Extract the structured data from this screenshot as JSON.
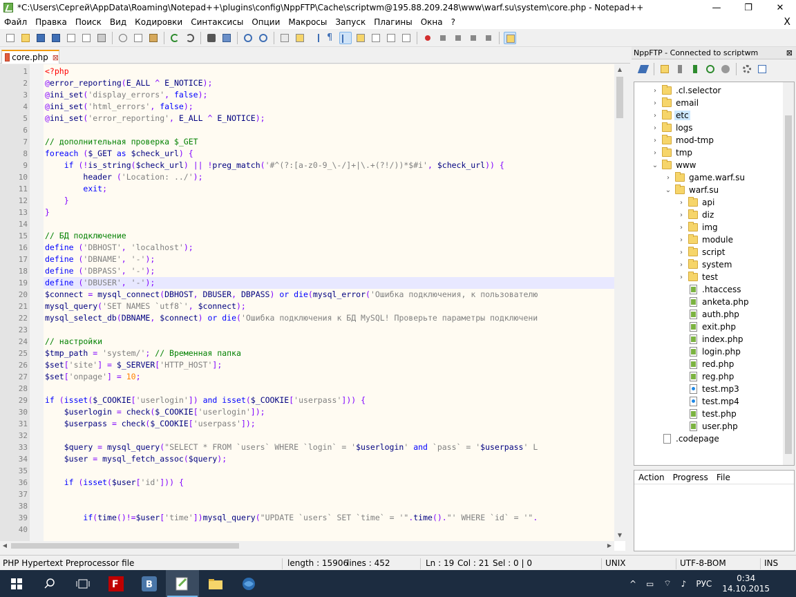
{
  "window": {
    "title": "*C:\\Users\\Сергей\\AppData\\Roaming\\Notepad++\\plugins\\config\\NppFTP\\Cache\\scriptwm@195.88.209.248\\www\\warf.su\\system\\core.php - Notepad++",
    "minimize": "—",
    "maximize": "❐",
    "close": "✕"
  },
  "menu": {
    "items": [
      "Файл",
      "Правка",
      "Поиск",
      "Вид",
      "Кодировки",
      "Синтаксисы",
      "Опции",
      "Макросы",
      "Запуск",
      "Плагины",
      "Окна",
      "?"
    ],
    "close": "X"
  },
  "tab": {
    "label": "core.php",
    "close": "⊠"
  },
  "code": {
    "line_numbers": [
      "1",
      "2",
      "3",
      "4",
      "5",
      "6",
      "7",
      "8",
      "9",
      "10",
      "11",
      "12",
      "13",
      "14",
      "15",
      "16",
      "17",
      "18",
      "19",
      "20",
      "21",
      "22",
      "23",
      "24",
      "25",
      "26",
      "27",
      "28",
      "29",
      "30",
      "31",
      "32",
      "33",
      "34",
      "35",
      "36",
      "37",
      "38",
      "39",
      "40"
    ],
    "current_line": 19,
    "lines": [
      [
        [
          "php",
          "<?php"
        ]
      ],
      [
        [
          "op",
          "@"
        ],
        [
          "fn",
          "error_reporting"
        ],
        [
          "op",
          "("
        ],
        [
          "fn",
          "E_ALL"
        ],
        [
          "op",
          " ^ "
        ],
        [
          "fn",
          "E_NOTICE"
        ],
        [
          "op",
          ");"
        ]
      ],
      [
        [
          "op",
          "@"
        ],
        [
          "fn",
          "ini_set"
        ],
        [
          "op",
          "("
        ],
        [
          "str",
          "'display_errors'"
        ],
        [
          "op",
          ", "
        ],
        [
          "kw",
          "false"
        ],
        [
          "op",
          ");"
        ]
      ],
      [
        [
          "op",
          "@"
        ],
        [
          "fn",
          "ini_set"
        ],
        [
          "op",
          "("
        ],
        [
          "str",
          "'html_errors'"
        ],
        [
          "op",
          ", "
        ],
        [
          "kw",
          "false"
        ],
        [
          "op",
          ");"
        ]
      ],
      [
        [
          "op",
          "@"
        ],
        [
          "fn",
          "ini_set"
        ],
        [
          "op",
          "("
        ],
        [
          "str",
          "'error_reporting'"
        ],
        [
          "op",
          ", "
        ],
        [
          "fn",
          "E_ALL"
        ],
        [
          "op",
          " ^ "
        ],
        [
          "fn",
          "E_NOTICE"
        ],
        [
          "op",
          ");"
        ]
      ],
      [],
      [
        [
          "cmt",
          "// дополнительная проверка $_GET"
        ]
      ],
      [
        [
          "kw",
          "foreach"
        ],
        [
          "op",
          " ("
        ],
        [
          "var",
          "$_GET"
        ],
        [
          "kw",
          " as "
        ],
        [
          "var",
          "$check_url"
        ],
        [
          "op",
          ") {"
        ]
      ],
      [
        [
          "op",
          "    "
        ],
        [
          "kw",
          "if"
        ],
        [
          "op",
          " (!"
        ],
        [
          "fn",
          "is_string"
        ],
        [
          "op",
          "("
        ],
        [
          "var",
          "$check_url"
        ],
        [
          "op",
          ") || !"
        ],
        [
          "fn",
          "preg_match"
        ],
        [
          "op",
          "("
        ],
        [
          "str",
          "'#^(?:[a-z0-9_\\-/]+|\\.+(?!/))*$#i'"
        ],
        [
          "op",
          ", "
        ],
        [
          "var",
          "$check_url"
        ],
        [
          "op",
          ")) {"
        ]
      ],
      [
        [
          "op",
          "        "
        ],
        [
          "fn",
          "header"
        ],
        [
          "op",
          " ("
        ],
        [
          "str",
          "'Location: ../'"
        ],
        [
          "op",
          ");"
        ]
      ],
      [
        [
          "op",
          "        "
        ],
        [
          "kw",
          "exit"
        ],
        [
          "op",
          ";"
        ]
      ],
      [
        [
          "op",
          "    }"
        ]
      ],
      [
        [
          "op",
          "}"
        ]
      ],
      [],
      [
        [
          "cmt",
          "// БД подключение"
        ]
      ],
      [
        [
          "kw",
          "define"
        ],
        [
          "op",
          " ("
        ],
        [
          "str",
          "'DBHOST'"
        ],
        [
          "op",
          ", "
        ],
        [
          "str",
          "'localhost'"
        ],
        [
          "op",
          ");"
        ]
      ],
      [
        [
          "kw",
          "define"
        ],
        [
          "op",
          " ("
        ],
        [
          "str",
          "'DBNAME'"
        ],
        [
          "op",
          ", "
        ],
        [
          "str",
          "'-'"
        ],
        [
          "op",
          ");"
        ]
      ],
      [
        [
          "kw",
          "define"
        ],
        [
          "op",
          " ("
        ],
        [
          "str",
          "'DBPASS'"
        ],
        [
          "op",
          ", "
        ],
        [
          "str",
          "'-'"
        ],
        [
          "op",
          ");"
        ]
      ],
      [
        [
          "kw",
          "define"
        ],
        [
          "op",
          " ("
        ],
        [
          "str",
          "'DBUSER'"
        ],
        [
          "op",
          ", "
        ],
        [
          "str",
          "'-'"
        ],
        [
          "op",
          ");"
        ]
      ],
      [
        [
          "var",
          "$connect"
        ],
        [
          "op",
          " = "
        ],
        [
          "fn",
          "mysql_connect"
        ],
        [
          "op",
          "("
        ],
        [
          "fn",
          "DBHOST"
        ],
        [
          "op",
          ", "
        ],
        [
          "fn",
          "DBUSER"
        ],
        [
          "op",
          ", "
        ],
        [
          "fn",
          "DBPASS"
        ],
        [
          "op",
          ") "
        ],
        [
          "kw",
          "or"
        ],
        [
          "op",
          " "
        ],
        [
          "kw",
          "die"
        ],
        [
          "op",
          "("
        ],
        [
          "fn",
          "mysql_error"
        ],
        [
          "op",
          "("
        ],
        [
          "str",
          "'Ошибка подключения, к пользователю"
        ]
      ],
      [
        [
          "fn",
          "mysql_query"
        ],
        [
          "op",
          "("
        ],
        [
          "str",
          "'SET NAMES `utf8`'"
        ],
        [
          "op",
          ", "
        ],
        [
          "var",
          "$connect"
        ],
        [
          "op",
          ");"
        ]
      ],
      [
        [
          "fn",
          "mysql_select_db"
        ],
        [
          "op",
          "("
        ],
        [
          "fn",
          "DBNAME"
        ],
        [
          "op",
          ", "
        ],
        [
          "var",
          "$connect"
        ],
        [
          "op",
          ") "
        ],
        [
          "kw",
          "or"
        ],
        [
          "op",
          " "
        ],
        [
          "kw",
          "die"
        ],
        [
          "op",
          "("
        ],
        [
          "str",
          "'Ошибка подключения к БД MySQL! Проверьте параметры подключени"
        ]
      ],
      [],
      [
        [
          "cmt",
          "// настройки"
        ]
      ],
      [
        [
          "var",
          "$tmp_path"
        ],
        [
          "op",
          " = "
        ],
        [
          "str",
          "'system/'"
        ],
        [
          "op",
          "; "
        ],
        [
          "cmt",
          "// Временная папка"
        ]
      ],
      [
        [
          "var",
          "$set"
        ],
        [
          "op",
          "["
        ],
        [
          "str",
          "'site'"
        ],
        [
          "op",
          "] = "
        ],
        [
          "var",
          "$_SERVER"
        ],
        [
          "op",
          "["
        ],
        [
          "str",
          "'HTTP_HOST'"
        ],
        [
          "op",
          "];"
        ]
      ],
      [
        [
          "var",
          "$set"
        ],
        [
          "op",
          "["
        ],
        [
          "str",
          "'onpage'"
        ],
        [
          "op",
          "] = "
        ],
        [
          "num",
          "10"
        ],
        [
          "op",
          ";"
        ]
      ],
      [],
      [
        [
          "kw",
          "if"
        ],
        [
          "op",
          " ("
        ],
        [
          "kw",
          "isset"
        ],
        [
          "op",
          "("
        ],
        [
          "var",
          "$_COOKIE"
        ],
        [
          "op",
          "["
        ],
        [
          "str",
          "'userlogin'"
        ],
        [
          "op",
          "]) "
        ],
        [
          "kw",
          "and"
        ],
        [
          "op",
          " "
        ],
        [
          "kw",
          "isset"
        ],
        [
          "op",
          "("
        ],
        [
          "var",
          "$_COOKIE"
        ],
        [
          "op",
          "["
        ],
        [
          "str",
          "'userpass'"
        ],
        [
          "op",
          "])) {"
        ]
      ],
      [
        [
          "op",
          "    "
        ],
        [
          "var",
          "$userlogin"
        ],
        [
          "op",
          " = "
        ],
        [
          "fn",
          "check"
        ],
        [
          "op",
          "("
        ],
        [
          "var",
          "$_COOKIE"
        ],
        [
          "op",
          "["
        ],
        [
          "str",
          "'userlogin'"
        ],
        [
          "op",
          "]);"
        ]
      ],
      [
        [
          "op",
          "    "
        ],
        [
          "var",
          "$userpass"
        ],
        [
          "op",
          " = "
        ],
        [
          "fn",
          "check"
        ],
        [
          "op",
          "("
        ],
        [
          "var",
          "$_COOKIE"
        ],
        [
          "op",
          "["
        ],
        [
          "str",
          "'userpass'"
        ],
        [
          "op",
          "]);"
        ]
      ],
      [],
      [
        [
          "op",
          "    "
        ],
        [
          "var",
          "$query"
        ],
        [
          "op",
          " = "
        ],
        [
          "fn",
          "mysql_query"
        ],
        [
          "op",
          "("
        ],
        [
          "str",
          "\"SELECT * FROM `users` WHERE `login` = '"
        ],
        [
          "var",
          "$userlogin"
        ],
        [
          "str",
          "' "
        ],
        [
          "kw",
          "and"
        ],
        [
          "str",
          " `pass` = '"
        ],
        [
          "var",
          "$userpass"
        ],
        [
          "str",
          "' L"
        ]
      ],
      [
        [
          "op",
          "    "
        ],
        [
          "var",
          "$user"
        ],
        [
          "op",
          " = "
        ],
        [
          "fn",
          "mysql_fetch_assoc"
        ],
        [
          "op",
          "("
        ],
        [
          "var",
          "$query"
        ],
        [
          "op",
          ");"
        ]
      ],
      [],
      [
        [
          "op",
          "    "
        ],
        [
          "kw",
          "if"
        ],
        [
          "op",
          " ("
        ],
        [
          "kw",
          "isset"
        ],
        [
          "op",
          "("
        ],
        [
          "var",
          "$user"
        ],
        [
          "op",
          "["
        ],
        [
          "str",
          "'id'"
        ],
        [
          "op",
          "])) {"
        ]
      ],
      [],
      [],
      [
        [
          "op",
          "        "
        ],
        [
          "kw",
          "if"
        ],
        [
          "op",
          "("
        ],
        [
          "fn",
          "time"
        ],
        [
          "op",
          "()!="
        ],
        [
          "var",
          "$user"
        ],
        [
          "op",
          "["
        ],
        [
          "str",
          "'time'"
        ],
        [
          "op",
          "])"
        ],
        [
          "fn",
          "mysql_query"
        ],
        [
          "op",
          "("
        ],
        [
          "str",
          "\"UPDATE `users` SET `time` = '\""
        ],
        [
          "op",
          "."
        ],
        [
          "fn",
          "time"
        ],
        [
          "op",
          "()."
        ],
        [
          "str",
          "\"' WHERE `id` = '\""
        ],
        [
          "op",
          "."
        ]
      ],
      []
    ]
  },
  "ftp": {
    "title": "NppFTP - Connected to scriptwm",
    "close": "⊠",
    "tree": [
      {
        "label": ".cl.selector",
        "type": "folder",
        "depth": 0,
        "expander": "›"
      },
      {
        "label": "email",
        "type": "folder",
        "depth": 0,
        "expander": "›"
      },
      {
        "label": "etc",
        "type": "folder",
        "depth": 0,
        "expander": "›",
        "selected": true
      },
      {
        "label": "logs",
        "type": "folder",
        "depth": 0,
        "expander": "›"
      },
      {
        "label": "mod-tmp",
        "type": "folder",
        "depth": 0,
        "expander": "›"
      },
      {
        "label": "tmp",
        "type": "folder",
        "depth": 0,
        "expander": "›"
      },
      {
        "label": "www",
        "type": "folder",
        "depth": 0,
        "expander": "⌄"
      },
      {
        "label": "game.warf.su",
        "type": "folder",
        "depth": 1,
        "expander": "›"
      },
      {
        "label": "warf.su",
        "type": "folder",
        "depth": 1,
        "expander": "⌄"
      },
      {
        "label": "api",
        "type": "folder",
        "depth": 2,
        "expander": "›"
      },
      {
        "label": "diz",
        "type": "folder",
        "depth": 2,
        "expander": "›"
      },
      {
        "label": "img",
        "type": "folder",
        "depth": 2,
        "expander": "›"
      },
      {
        "label": "module",
        "type": "folder",
        "depth": 2,
        "expander": "›"
      },
      {
        "label": "script",
        "type": "folder",
        "depth": 2,
        "expander": "›"
      },
      {
        "label": "system",
        "type": "folder",
        "depth": 2,
        "expander": "›"
      },
      {
        "label": "test",
        "type": "folder",
        "depth": 2,
        "expander": "›"
      },
      {
        "label": ".htaccess",
        "type": "php",
        "depth": 2
      },
      {
        "label": "anketa.php",
        "type": "php",
        "depth": 2
      },
      {
        "label": "auth.php",
        "type": "php",
        "depth": 2
      },
      {
        "label": "exit.php",
        "type": "php",
        "depth": 2
      },
      {
        "label": "index.php",
        "type": "php",
        "depth": 2
      },
      {
        "label": "login.php",
        "type": "php",
        "depth": 2
      },
      {
        "label": "red.php",
        "type": "php",
        "depth": 2
      },
      {
        "label": "reg.php",
        "type": "php",
        "depth": 2
      },
      {
        "label": "test.mp3",
        "type": "media",
        "depth": 2
      },
      {
        "label": "test.mp4",
        "type": "media",
        "depth": 2
      },
      {
        "label": "test.php",
        "type": "php",
        "depth": 2
      },
      {
        "label": "user.php",
        "type": "php",
        "depth": 2
      },
      {
        "label": ".codepage",
        "type": "file",
        "depth": 0
      }
    ],
    "queue_headers": [
      "Action",
      "Progress",
      "File"
    ]
  },
  "status": {
    "filetype": "PHP Hypertext Preprocessor file",
    "length": "length : 15906",
    "lines": "lines : 452",
    "ln": "Ln : 19",
    "col": "Col : 21",
    "sel": "Sel : 0 | 0",
    "eol": "UNIX",
    "encoding": "UTF-8-BOM",
    "mode": "INS"
  },
  "taskbar": {
    "lang": "РУС",
    "time": "0:34",
    "date": "14.10.2015"
  },
  "colors": {
    "keyword": "#0000ff",
    "comment": "#008000",
    "string": "#808080",
    "number": "#ff8000",
    "php_tag": "#ff0000"
  }
}
